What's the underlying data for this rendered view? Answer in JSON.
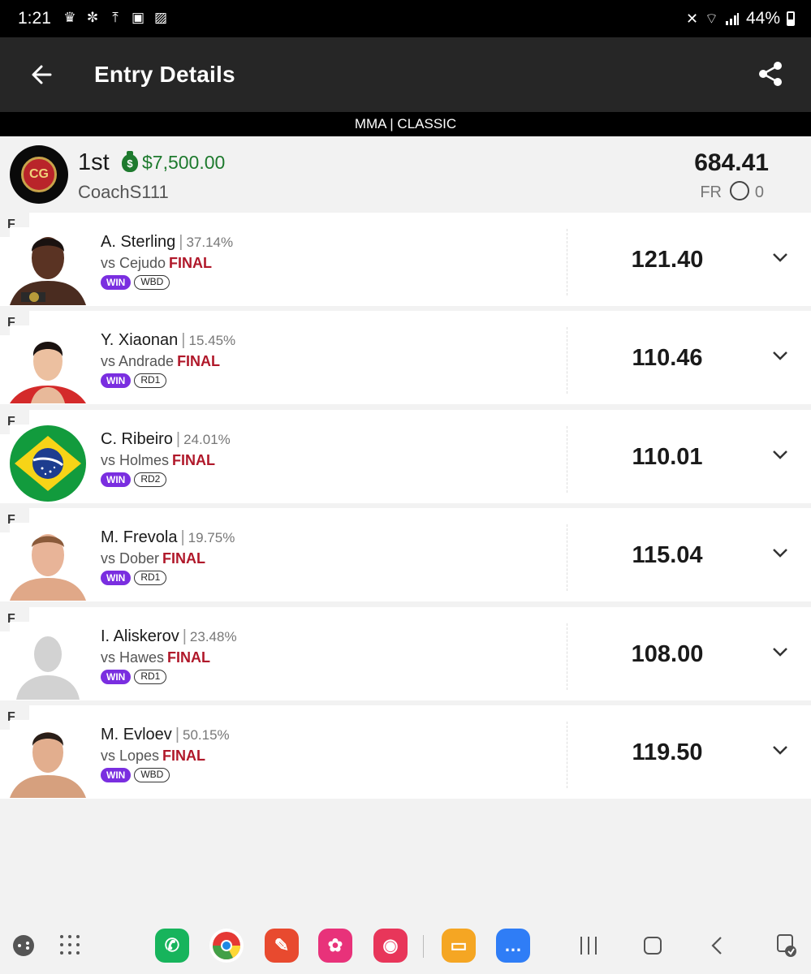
{
  "status_bar": {
    "time": "1:21",
    "battery": "44%"
  },
  "app_bar": {
    "title": "Entry Details"
  },
  "subheader": "MMA | CLASSIC",
  "entry": {
    "rank": "1st",
    "prize": "$7,500.00",
    "username": "CoachS111",
    "total_score": "684.41",
    "fr_label": "FR",
    "fr_count": "0"
  },
  "fighters": [
    {
      "position": "F",
      "name": "A. Sterling",
      "ownership": "37.14%",
      "opponent": "vs Cejudo",
      "status": "FINAL",
      "result": "WIN",
      "method": "WBD",
      "points": "121.40",
      "photo": "fighter-photo"
    },
    {
      "position": "F",
      "name": "Y. Xiaonan",
      "ownership": "15.45%",
      "opponent": "vs Andrade",
      "status": "FINAL",
      "result": "WIN",
      "method": "RD1",
      "points": "110.46",
      "photo": "fighter-photo"
    },
    {
      "position": "F",
      "name": "C. Ribeiro",
      "ownership": "24.01%",
      "opponent": "vs Holmes",
      "status": "FINAL",
      "result": "WIN",
      "method": "RD2",
      "points": "110.01",
      "photo": "brazil-flag"
    },
    {
      "position": "F",
      "name": "M. Frevola",
      "ownership": "19.75%",
      "opponent": "vs Dober",
      "status": "FINAL",
      "result": "WIN",
      "method": "RD1",
      "points": "115.04",
      "photo": "fighter-photo"
    },
    {
      "position": "F",
      "name": "I. Aliskerov",
      "ownership": "23.48%",
      "opponent": "vs Hawes",
      "status": "FINAL",
      "result": "WIN",
      "method": "RD1",
      "points": "108.00",
      "photo": "placeholder-silhouette"
    },
    {
      "position": "F",
      "name": "M. Evloev",
      "ownership": "50.15%",
      "opponent": "vs Lopes",
      "status": "FINAL",
      "result": "WIN",
      "method": "WBD",
      "points": "119.50",
      "photo": "fighter-photo"
    }
  ],
  "colors": {
    "app_bar": "#262626",
    "prize_green": "#1e7a2e",
    "final_red": "#b0182a",
    "win_purple": "#7a2ee0"
  },
  "nav_bar": {
    "apps": [
      "game-launcher-icon",
      "app-drawer-icon",
      "phone-icon",
      "chrome-icon",
      "notes-icon",
      "flower-icon",
      "camera-icon",
      "files-icon",
      "messages-icon"
    ],
    "system": [
      "recents-icon",
      "home-icon",
      "back-nav-icon",
      "accessibility-icon"
    ]
  }
}
